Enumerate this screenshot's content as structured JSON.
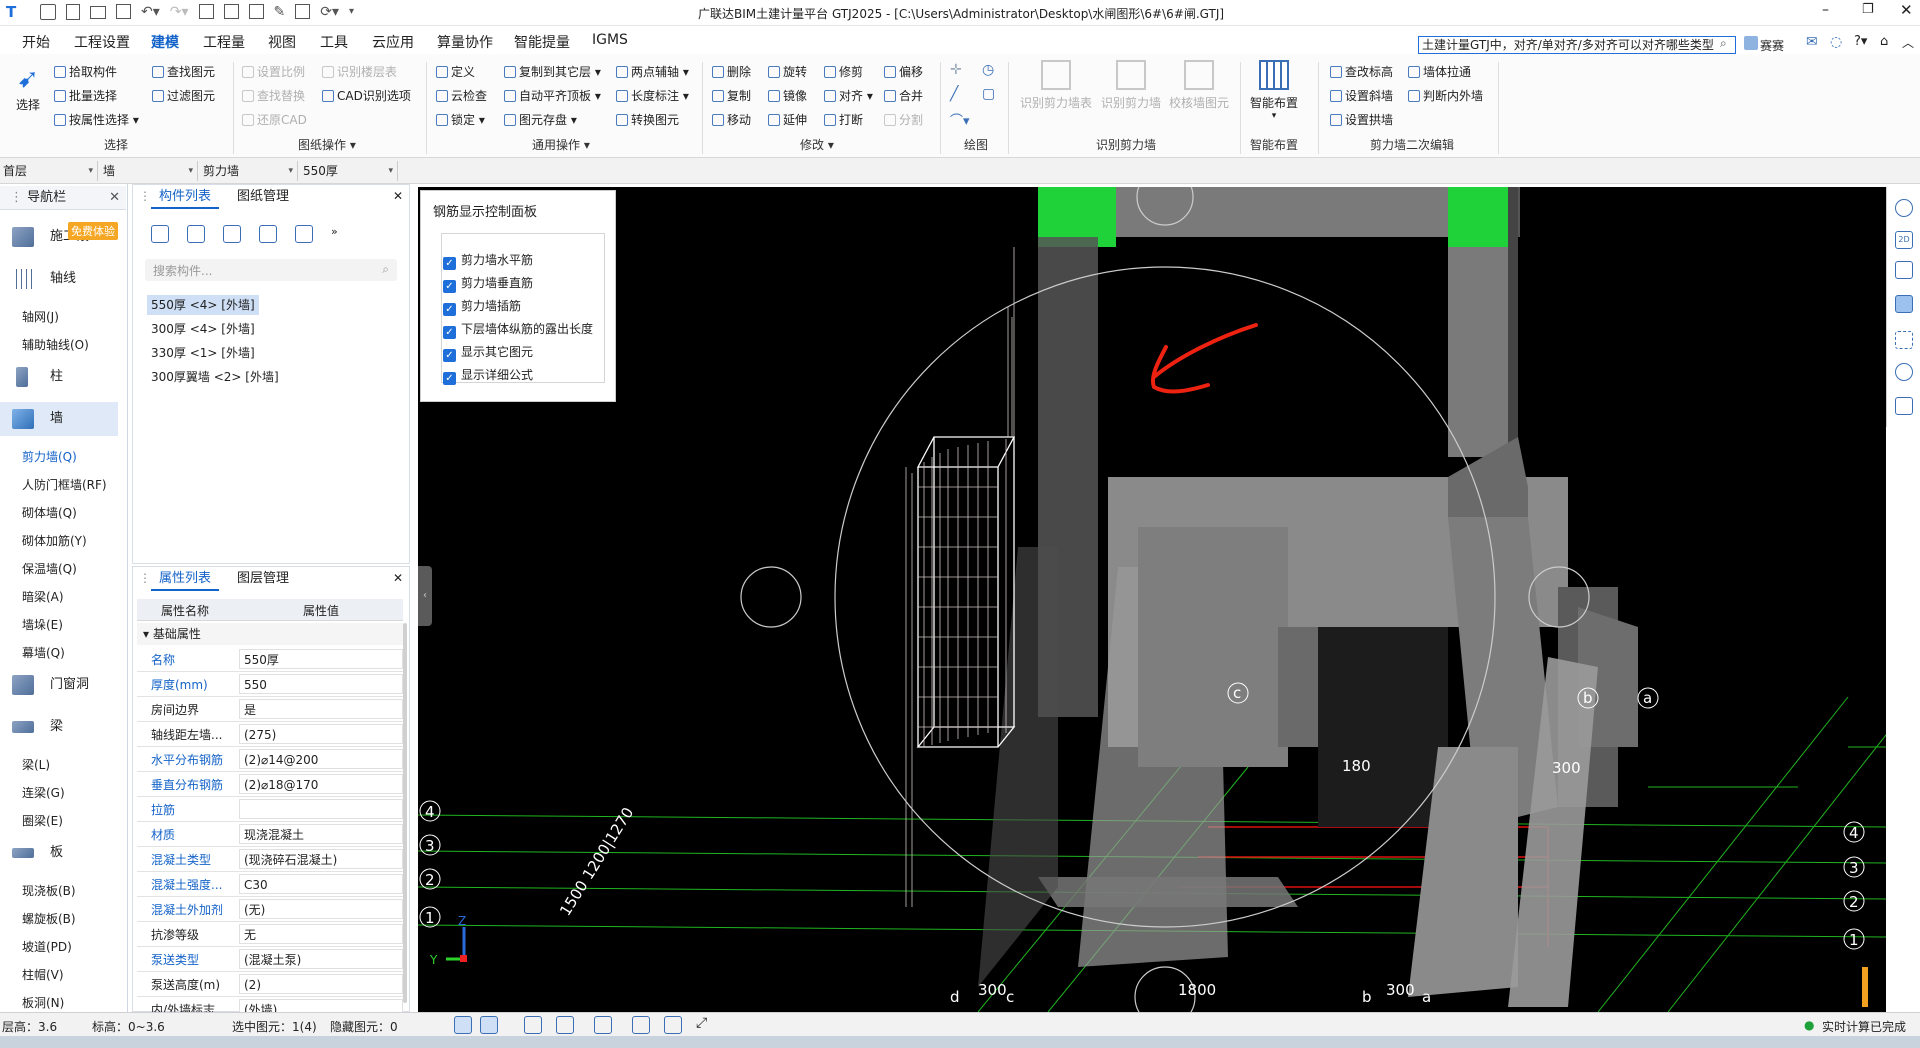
{
  "title": "广联达BIM土建计量平台 GTJ2025 - [C:\\Users\\Administrator\\Desktop\\水闸图形\\6#\\6#闸.GTJ]",
  "search_value": "土建计量GTJ中，对齐/单对齐/多对齐可以对齐哪些类型",
  "saisai": "赛赛",
  "menu": [
    "开始",
    "工程设置",
    "建模",
    "工程量",
    "视图",
    "工具",
    "云应用",
    "算量协作",
    "智能提量",
    "IGMS"
  ],
  "ribbon": {
    "select_big": "选择",
    "select_items": [
      "拾取构件",
      "批量选择",
      "按属性选择",
      "查找图元",
      "过滤图元"
    ],
    "select_label": "选择",
    "draw_items": [
      "设置比例",
      "识别楼层表",
      "查找替换",
      "CAD识别选项",
      "还原CAD"
    ],
    "draw_label": "图纸操作",
    "common_items": [
      "定义",
      "复制到其它层",
      "两点辅轴",
      "云检查",
      "自动平齐顶板",
      "长度标注",
      "锁定",
      "图元存盘",
      "转换图元"
    ],
    "common_label": "通用操作",
    "modify_items": [
      "删除",
      "旋转",
      "修剪",
      "偏移",
      "复制",
      "镜像",
      "对齐",
      "合并",
      "移动",
      "延伸",
      "打断",
      "分割"
    ],
    "modify_label": "修改",
    "draw2_label": "绘图",
    "recog_items": [
      "识别剪力墙表",
      "识别剪力墙",
      "校核墙图元"
    ],
    "recog_label": "识别剪力墙",
    "smart_item": "智能布置",
    "smart_label": "智能布置",
    "edit_items": [
      "查改标高",
      "墙体拉通",
      "设置斜墙",
      "判断内外墙",
      "设置拱墙"
    ],
    "edit_label": "剪力墙二次编辑"
  },
  "selbar": [
    "首层",
    "墙",
    "剪力墙",
    "550厚"
  ],
  "nav": {
    "title": "导航栏",
    "badge": "免费体验",
    "cats": [
      "施工段",
      "轴线",
      "柱",
      "墙",
      "门窗洞",
      "梁",
      "板"
    ],
    "axis_items": [
      "轴网(J)",
      "辅助轴线(O)"
    ],
    "wall_items": [
      "剪力墙(Q)",
      "人防门框墙(RF)",
      "砌体墙(Q)",
      "砌体加筋(Y)",
      "保温墙(Q)",
      "暗梁(A)",
      "墙垛(E)",
      "幕墙(Q)"
    ],
    "beam_items": [
      "梁(L)",
      "连梁(G)",
      "圈梁(E)"
    ],
    "slab_items": [
      "现浇板(B)",
      "螺旋板(B)",
      "坡道(PD)",
      "柱帽(V)",
      "板洞(N)"
    ]
  },
  "complist": {
    "tabs": [
      "构件列表",
      "图纸管理"
    ],
    "search_placeholder": "搜索构件...",
    "items": [
      "550厚 <4> [外墙]",
      "300厚 <4> [外墙]",
      "330厚 <1> [外墙]",
      "300厚翼墙 <2> [外墙]"
    ]
  },
  "proplist": {
    "tabs": [
      "属性列表",
      "图层管理"
    ],
    "headers": [
      "属性名称",
      "属性值"
    ],
    "group": "基础属性",
    "rows": [
      {
        "n": "名称",
        "v": "550厚",
        "blue": true
      },
      {
        "n": "厚度(mm)",
        "v": "550",
        "blue": true
      },
      {
        "n": "房间边界",
        "v": "是",
        "blue": false
      },
      {
        "n": "轴线距左墙...",
        "v": "(275)",
        "blue": false
      },
      {
        "n": "水平分布钢筋",
        "v": "(2)⌀14@200",
        "blue": true
      },
      {
        "n": "垂直分布钢筋",
        "v": "(2)⌀18@170",
        "blue": true
      },
      {
        "n": "拉筋",
        "v": "",
        "blue": true
      },
      {
        "n": "材质",
        "v": "现浇混凝土",
        "blue": true
      },
      {
        "n": "混凝土类型",
        "v": "(现浇碎石混凝土)",
        "blue": true
      },
      {
        "n": "混凝土强度...",
        "v": "C30",
        "blue": true
      },
      {
        "n": "混凝土外加剂",
        "v": "(无)",
        "blue": true
      },
      {
        "n": "抗渗等级",
        "v": "无",
        "blue": false
      },
      {
        "n": "泵送类型",
        "v": "(混凝土泵)",
        "blue": true
      },
      {
        "n": "泵送高度(m)",
        "v": "(2)",
        "blue": false
      },
      {
        "n": "内/外墙标志",
        "v": "(外墙)",
        "blue": false
      }
    ]
  },
  "rebar": {
    "title": "钢筋显示控制面板",
    "items": [
      "剪力墙水平筋",
      "剪力墙垂直筋",
      "剪力墙插筋",
      "下层墙体纵筋的露出长度",
      "显示其它图元",
      "显示详细公式"
    ]
  },
  "viewport_labels": {
    "axes_right": [
      "4",
      "3",
      "2",
      "1"
    ],
    "axes_left": [
      "4",
      "3",
      "2",
      "1"
    ],
    "letters_top": [
      "c",
      "b",
      "a"
    ],
    "letters_bottom": [
      "d",
      "c",
      "b",
      "a"
    ],
    "dims": [
      "180",
      "300",
      "300",
      "1800",
      "300",
      "1500 1200|1270"
    ],
    "z": "Z",
    "y": "Y"
  },
  "status": {
    "floor_h": "层高：3.6",
    "elev": "标高：0~3.6",
    "selected": "选中图元：1(4)",
    "hidden": "隐藏图元：0",
    "realtime": "实时计算已完成"
  }
}
